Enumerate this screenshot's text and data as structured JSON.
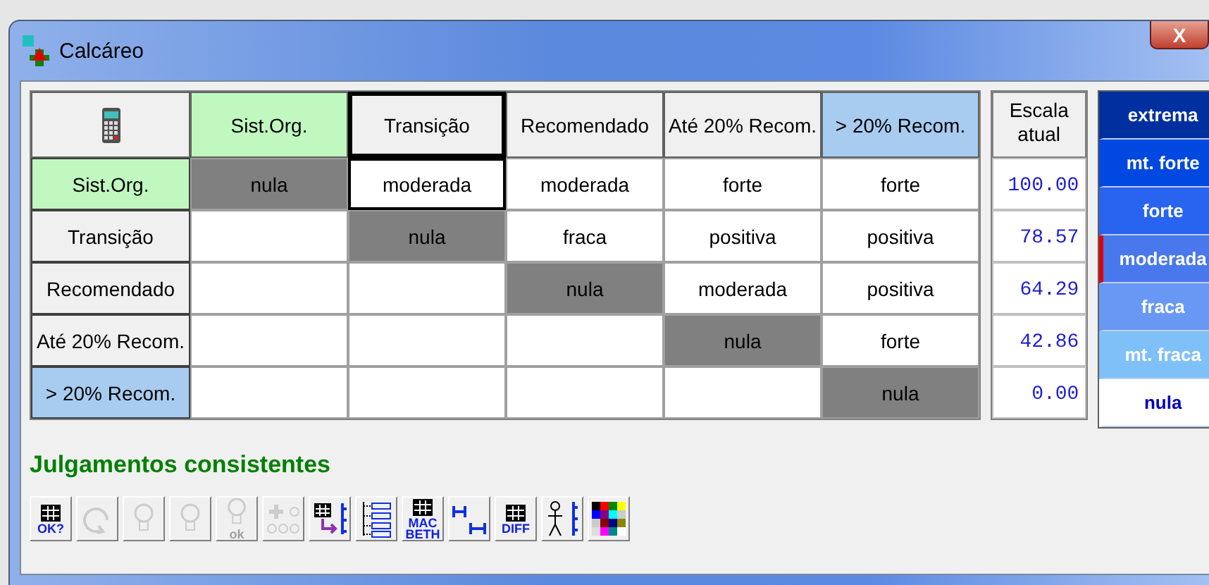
{
  "window": {
    "title": "Calcáreo",
    "close_label": "X"
  },
  "matrix": {
    "columns": [
      {
        "label": "Sist.Org.",
        "color": "#c0f8c0",
        "selected": false
      },
      {
        "label": "Transição",
        "color": "#f0f0f0",
        "selected": true
      },
      {
        "label": "Recomendado",
        "color": "#f0f0f0",
        "selected": false
      },
      {
        "label": "Até 20% Recom.",
        "color": "#f0f0f0",
        "selected": false
      },
      {
        "label": "> 20% Recom.",
        "color": "#a8ccf0",
        "selected": false
      }
    ],
    "rows": [
      {
        "label": "Sist.Org.",
        "color": "#c0f8c0",
        "cells": [
          {
            "kind": "diagonal",
            "text": "nula",
            "selected": false
          },
          {
            "kind": "judgment",
            "text": "moderada",
            "selected": true
          },
          {
            "kind": "judgment",
            "text": "moderada",
            "selected": false
          },
          {
            "kind": "judgment",
            "text": "forte",
            "selected": false
          },
          {
            "kind": "judgment",
            "text": "forte",
            "selected": false
          }
        ]
      },
      {
        "label": "Transição",
        "color": "#f0f0f0",
        "cells": [
          {
            "kind": "empty",
            "selected": false
          },
          {
            "kind": "diagonal",
            "text": "nula",
            "selected": false
          },
          {
            "kind": "judgment",
            "text": "fraca",
            "selected": false
          },
          {
            "kind": "judgment",
            "text": "positiva",
            "selected": false
          },
          {
            "kind": "judgment",
            "text": "positiva",
            "selected": false
          }
        ]
      },
      {
        "label": "Recomendado",
        "color": "#f0f0f0",
        "cells": [
          {
            "kind": "empty",
            "selected": false
          },
          {
            "kind": "empty",
            "selected": false
          },
          {
            "kind": "diagonal",
            "text": "nula",
            "selected": false
          },
          {
            "kind": "judgment",
            "text": "moderada",
            "selected": false
          },
          {
            "kind": "judgment",
            "text": "positiva",
            "selected": false
          }
        ]
      },
      {
        "label": "Até 20% Recom.",
        "color": "#f0f0f0",
        "cells": [
          {
            "kind": "empty",
            "selected": false
          },
          {
            "kind": "empty",
            "selected": false
          },
          {
            "kind": "empty",
            "selected": false
          },
          {
            "kind": "diagonal",
            "text": "nula",
            "selected": false
          },
          {
            "kind": "judgment",
            "text": "forte",
            "selected": false
          }
        ]
      },
      {
        "label": "> 20% Recom.",
        "color": "#a8ccf0",
        "cells": [
          {
            "kind": "empty",
            "selected": false
          },
          {
            "kind": "empty",
            "selected": false
          },
          {
            "kind": "empty",
            "selected": false
          },
          {
            "kind": "empty",
            "selected": false
          },
          {
            "kind": "diagonal",
            "text": "nula",
            "selected": false
          }
        ]
      }
    ]
  },
  "scale": {
    "title": "Escala atual",
    "values": [
      "100.00",
      "78.57",
      "64.29",
      "42.86",
      "0.00"
    ]
  },
  "legend": [
    {
      "label": "extrema",
      "color": "#0030a0",
      "selected": false
    },
    {
      "label": "mt. forte",
      "color": "#0048e0",
      "selected": false
    },
    {
      "label": "forte",
      "color": "#2864f0",
      "selected": false
    },
    {
      "label": "moderada",
      "color": "#4878ec",
      "selected": true
    },
    {
      "label": "fraca",
      "color": "#6898f4",
      "selected": false
    },
    {
      "label": "mt. fraca",
      "color": "#80c0f8",
      "selected": false
    },
    {
      "label": "nula",
      "color": "#ffffff",
      "selected": false
    }
  ],
  "status": "Julgamentos consistentes",
  "toolbar": [
    {
      "kind": "grid",
      "label": "OK?",
      "disabled": false
    },
    {
      "kind": "refresh",
      "disabled": true
    },
    {
      "kind": "bulb",
      "disabled": true
    },
    {
      "kind": "bulb-base",
      "disabled": true
    },
    {
      "kind": "bulb",
      "label": "ok",
      "disabled": true
    },
    {
      "kind": "bulb-plus",
      "disabled": true
    },
    {
      "kind": "grid-arrow",
      "disabled": false
    },
    {
      "kind": "list",
      "disabled": false
    },
    {
      "kind": "grid",
      "label": "MAC BETH",
      "disabled": false
    },
    {
      "kind": "ruler",
      "disabled": false
    },
    {
      "kind": "grid",
      "label": "DIFF",
      "disabled": false
    },
    {
      "kind": "figure",
      "disabled": false
    },
    {
      "kind": "palette",
      "disabled": false
    }
  ]
}
